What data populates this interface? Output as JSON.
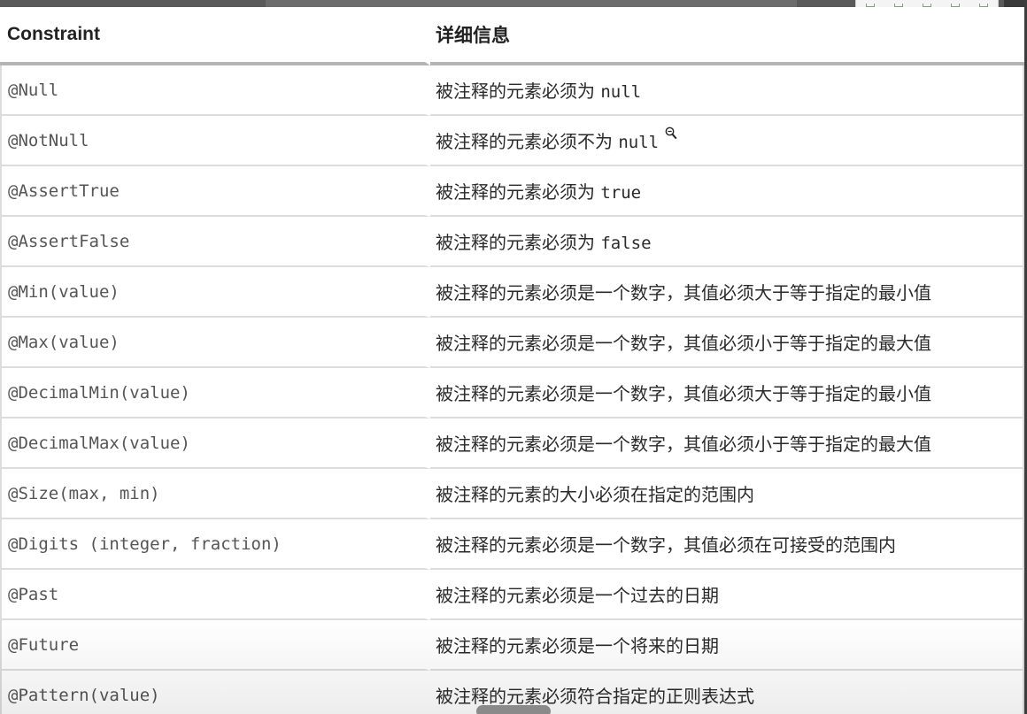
{
  "table": {
    "headers": {
      "constraint": "Constraint",
      "details": "详细信息"
    },
    "rows": [
      {
        "constraint": "@Null",
        "desc_text": "被注释的元素必须为 ",
        "desc_code": "null"
      },
      {
        "constraint": "@NotNull",
        "desc_text": "被注释的元素必须不为 ",
        "desc_code": "null"
      },
      {
        "constraint": "@AssertTrue",
        "desc_text": "被注释的元素必须为 ",
        "desc_code": "true"
      },
      {
        "constraint": "@AssertFalse",
        "desc_text": "被注释的元素必须为 ",
        "desc_code": "false"
      },
      {
        "constraint": "@Min(value)",
        "desc_text": "被注释的元素必须是一个数字，其值必须大于等于指定的最小值",
        "desc_code": ""
      },
      {
        "constraint": "@Max(value)",
        "desc_text": "被注释的元素必须是一个数字，其值必须小于等于指定的最大值",
        "desc_code": ""
      },
      {
        "constraint": "@DecimalMin(value)",
        "desc_text": "被注释的元素必须是一个数字，其值必须大于等于指定的最小值",
        "desc_code": ""
      },
      {
        "constraint": "@DecimalMax(value)",
        "desc_text": "被注释的元素必须是一个数字，其值必须小于等于指定的最大值",
        "desc_code": ""
      },
      {
        "constraint": "@Size(max, min)",
        "desc_text": "被注释的元素的大小必须在指定的范围内",
        "desc_code": ""
      },
      {
        "constraint": "@Digits (integer, fraction)",
        "desc_text": "被注释的元素必须是一个数字，其值必须在可接受的范围内",
        "desc_code": ""
      },
      {
        "constraint": "@Past",
        "desc_text": "被注释的元素必须是一个过去的日期",
        "desc_code": ""
      },
      {
        "constraint": "@Future",
        "desc_text": "被注释的元素必须是一个将来的日期",
        "desc_code": ""
      },
      {
        "constraint": "@Pattern(value)",
        "desc_text": "被注释的元素必须符合指定的正则表达式",
        "desc_code": ""
      }
    ]
  },
  "icons": {
    "cursor": "zoom-in-icon",
    "toolbar": [
      "toolbar-icon-1",
      "toolbar-icon-2",
      "toolbar-icon-3",
      "toolbar-icon-4",
      "toolbar-icon-5"
    ]
  },
  "colors": {
    "header_rule": "#b4b4b4",
    "row_rule": "#dcdcdc",
    "code_text": "#555555"
  }
}
